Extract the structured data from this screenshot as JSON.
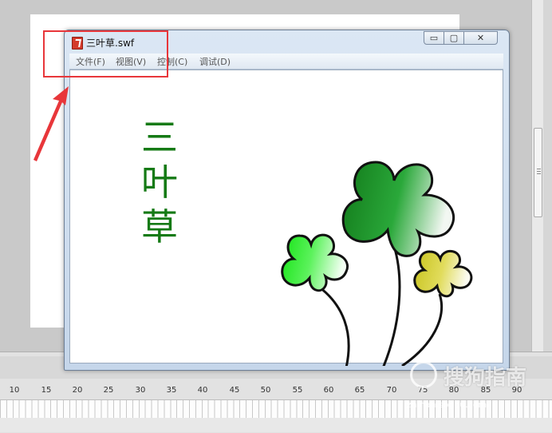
{
  "window": {
    "title": "三叶草.swf",
    "controls": {
      "minimize": "▭",
      "maximize": "▢",
      "close": "✕"
    }
  },
  "menu": [
    {
      "label": "文件(F)"
    },
    {
      "label": "视图(V)"
    },
    {
      "label": "控制(C)"
    },
    {
      "label": "调试(D)"
    }
  ],
  "artwork": {
    "title_chars": [
      "三",
      "叶",
      "草"
    ],
    "title_color": "#157a15",
    "clover_colors": {
      "large": "#1f9a2a",
      "left": "#2ef02e",
      "right": "#d8d230"
    }
  },
  "timeline": {
    "ruler_labels": [
      "10",
      "15",
      "20",
      "25",
      "30",
      "35",
      "40",
      "45",
      "50",
      "55",
      "60",
      "65",
      "70",
      "75",
      "80",
      "85",
      "90"
    ]
  },
  "watermark": {
    "brand": "搜狗指南",
    "url": "zhinan.sogou.com"
  },
  "highlight_color": "#e8363a"
}
